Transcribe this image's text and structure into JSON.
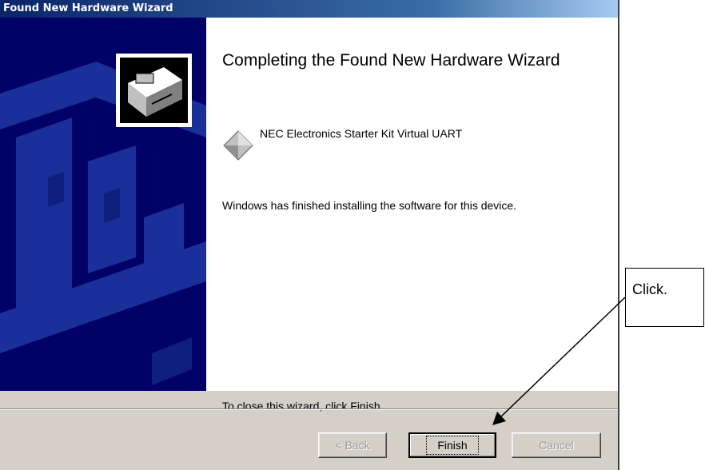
{
  "window": {
    "title": "Found New Hardware Wizard"
  },
  "main": {
    "heading": "Completing the Found New Hardware Wizard",
    "device_name": "NEC Electronics Starter Kit Virtual UART",
    "finish_message": "Windows has finished installing the software for this device.",
    "close_message": "To close this wizard, click Finish."
  },
  "buttons": {
    "back": "< Back",
    "finish": "Finish",
    "cancel": "Cancel"
  },
  "annotation": {
    "text": "Click."
  },
  "icons": {
    "wizard": "hardware-wizard-icon",
    "device": "device-diamond-icon"
  },
  "colors": {
    "titlebar_start": "#0a246a",
    "sidepanel": "#000066",
    "dialog_bg": "#d4d0c8"
  }
}
